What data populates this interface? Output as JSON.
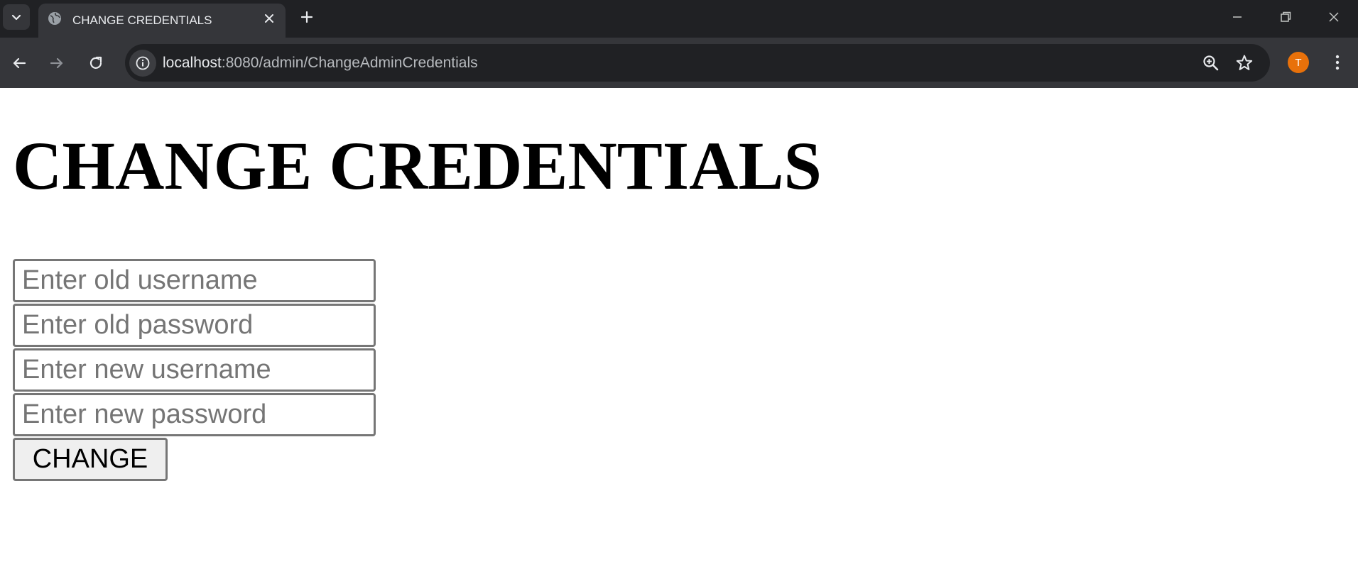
{
  "browser": {
    "tab_title": "CHANGE CREDENTIALS",
    "url_host": "localhost",
    "url_rest": ":8080/admin/ChangeAdminCredentials",
    "profile_initial": "T",
    "profile_color": "#e8710a"
  },
  "page": {
    "heading": "CHANGE CREDENTIALS",
    "fields": {
      "old_username_placeholder": "Enter old username",
      "old_password_placeholder": "Enter old password",
      "new_username_placeholder": "Enter new username",
      "new_password_placeholder": "Enter new password"
    },
    "submit_label": "CHANGE"
  }
}
